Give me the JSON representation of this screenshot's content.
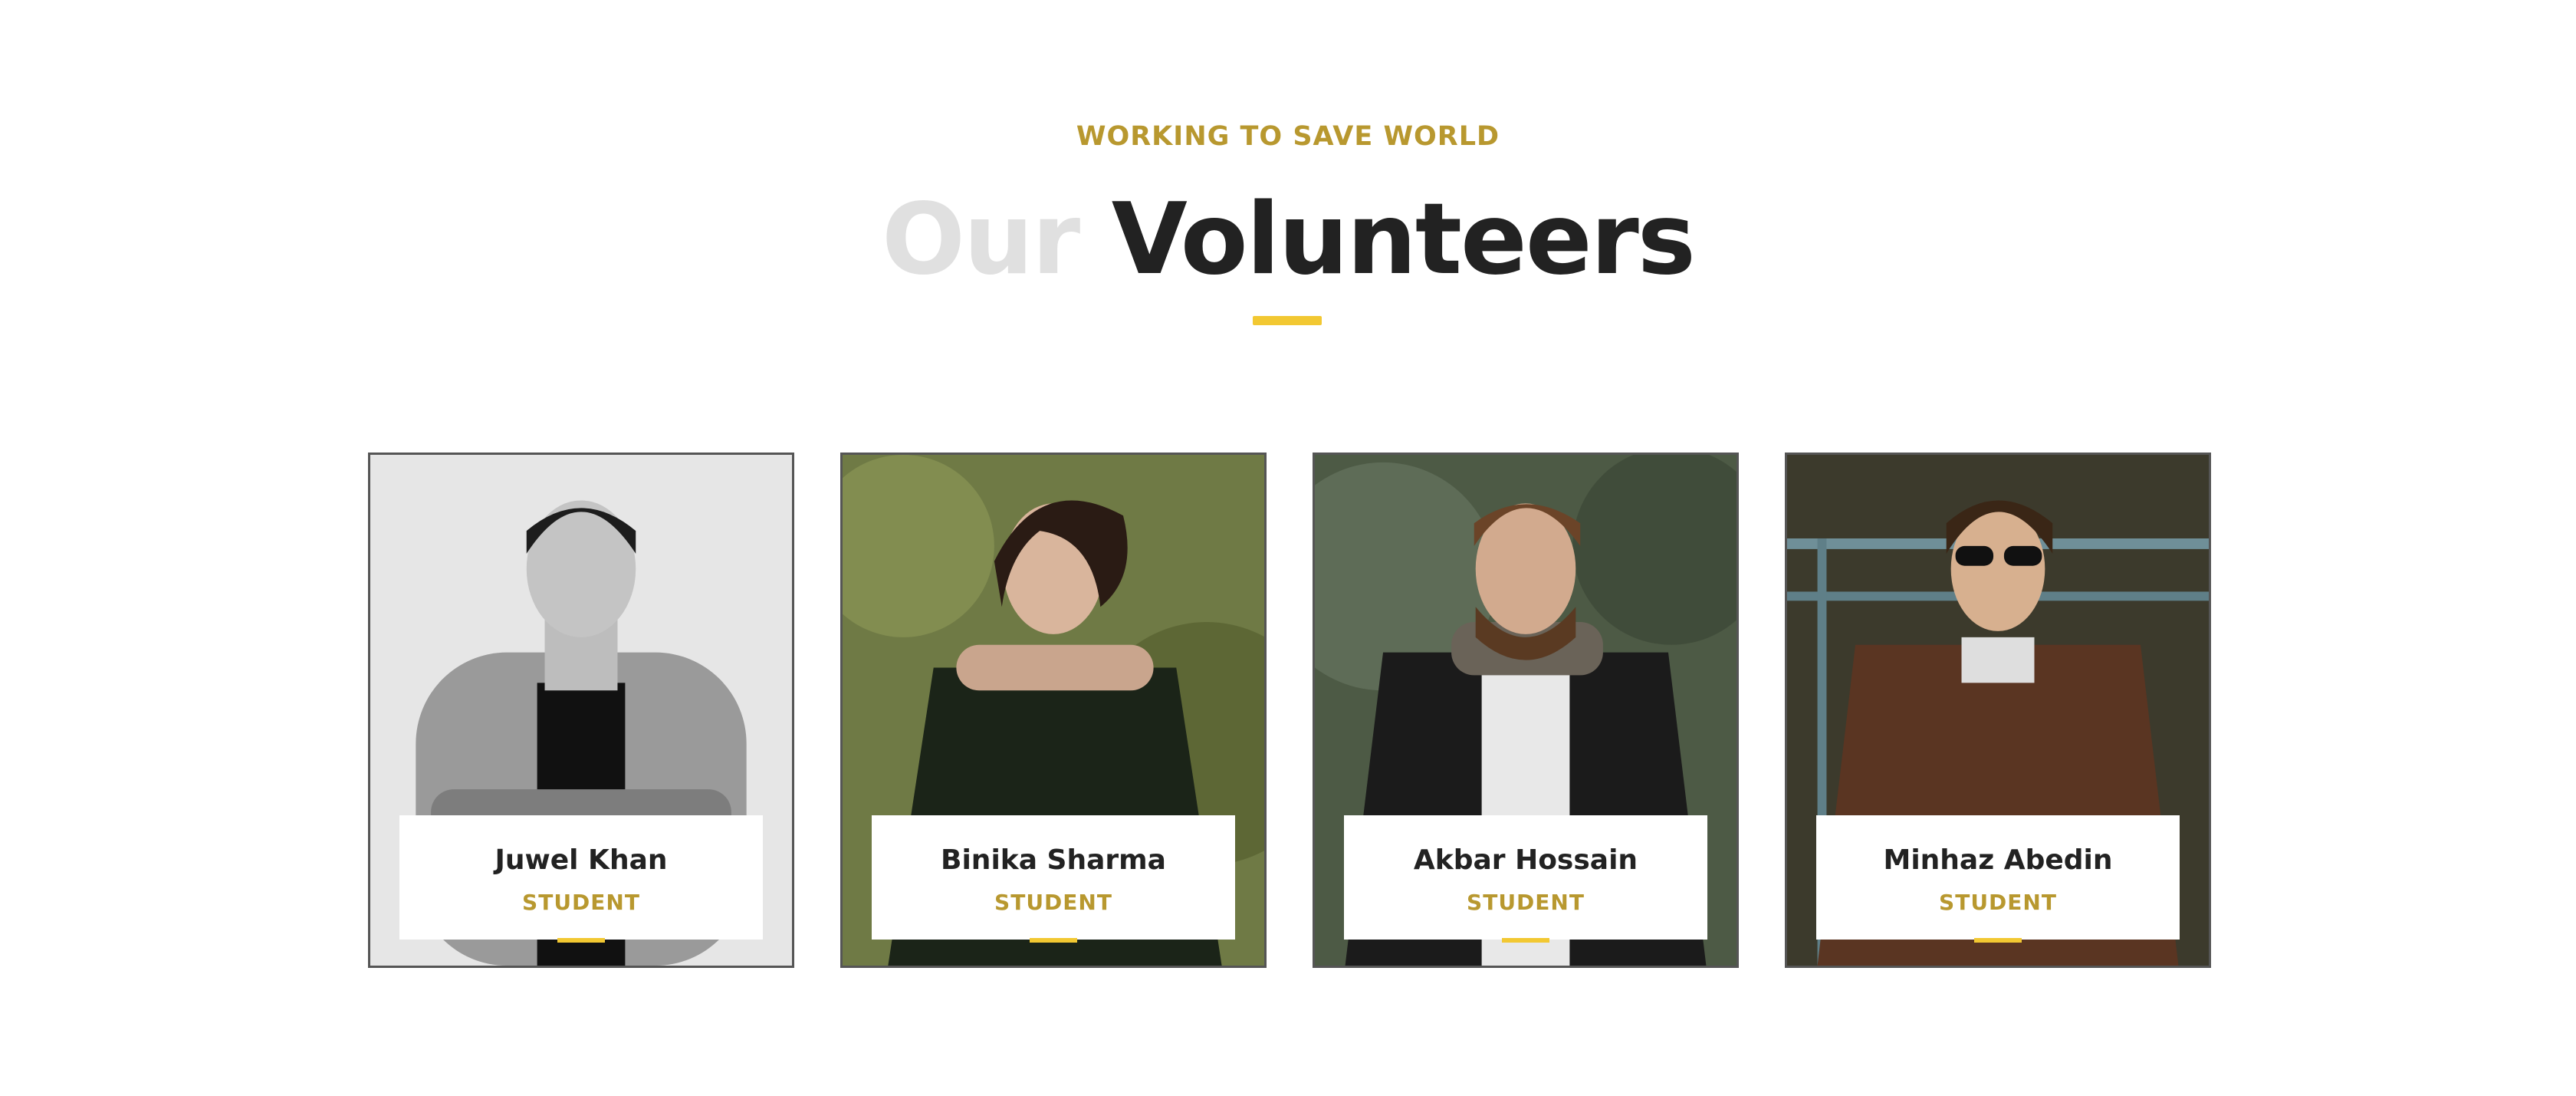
{
  "section": {
    "subtitle": "WORKING TO SAVE WORLD",
    "title_light": "Our",
    "title_dark": "Volunteers"
  },
  "volunteers": [
    {
      "name": "Juwel Khan",
      "role": "STUDENT"
    },
    {
      "name": "Binika Sharma",
      "role": "STUDENT"
    },
    {
      "name": "Akbar Hossain",
      "role": "STUDENT"
    },
    {
      "name": "Minhaz Abedin",
      "role": "STUDENT"
    }
  ],
  "colors": {
    "accent": "#f2c832",
    "gold_text": "#b8982f",
    "heading_dark": "#222222",
    "heading_light": "#e0e0e0"
  }
}
